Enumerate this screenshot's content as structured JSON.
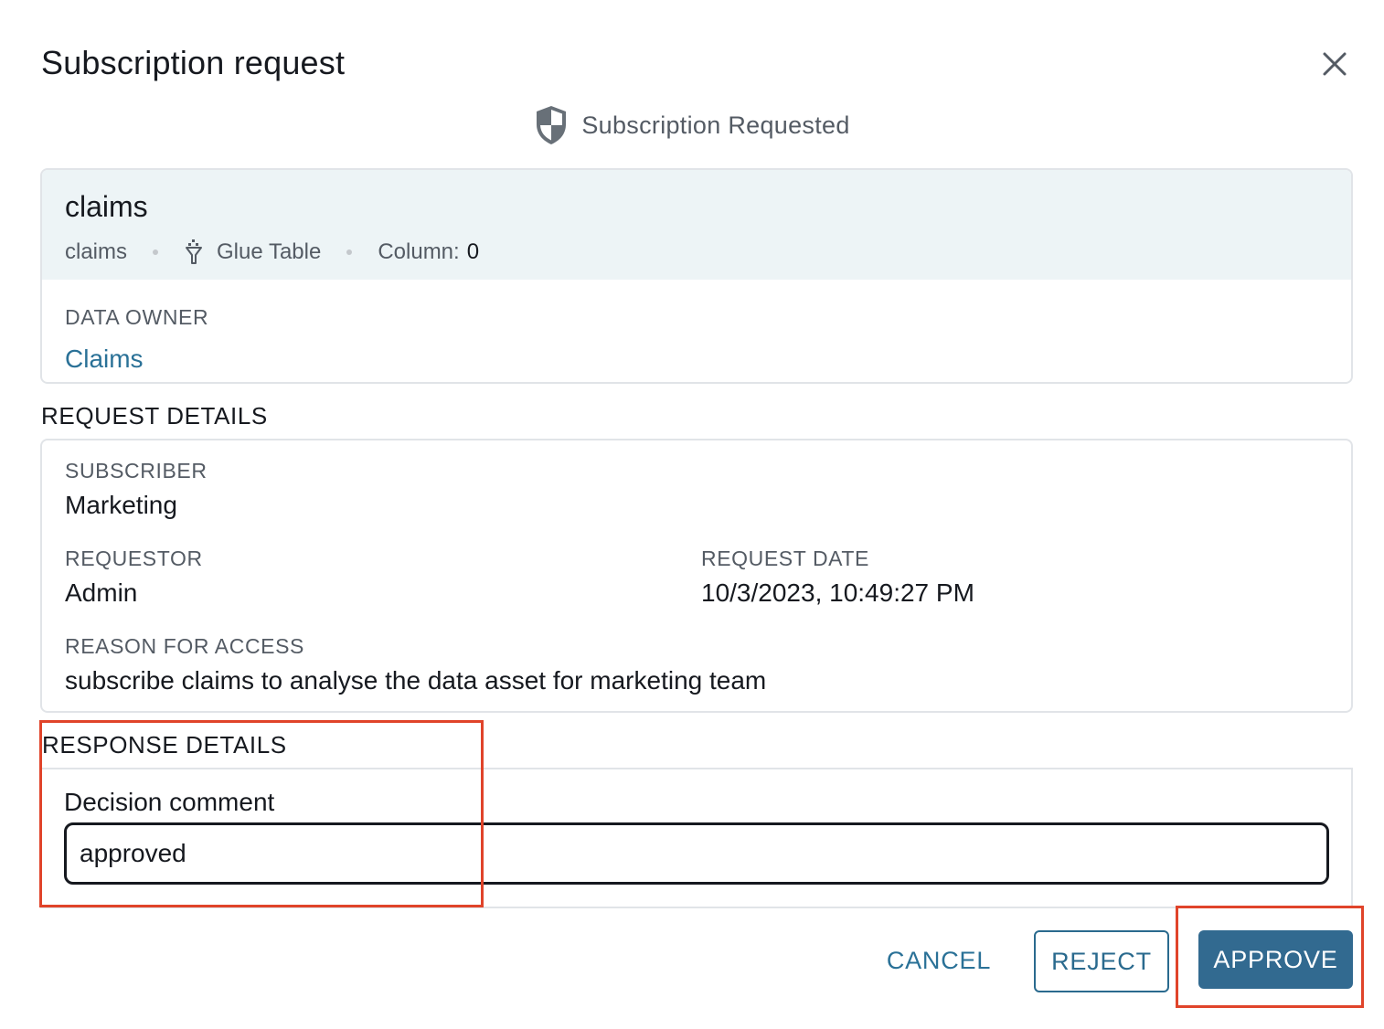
{
  "dialog": {
    "title": "Subscription request",
    "status": "Subscription Requested",
    "colors": {
      "accent": "#2a7197",
      "primary_button": "#326a90",
      "highlight": "#e0442a"
    }
  },
  "asset": {
    "name": "claims",
    "meta_name": "claims",
    "type_icon": "glue-table-icon",
    "type": "Glue Table",
    "column_label": "Column:",
    "column_count": "0",
    "data_owner_label": "DATA OWNER",
    "data_owner": "Claims"
  },
  "request_details": {
    "heading": "REQUEST DETAILS",
    "subscriber_label": "SUBSCRIBER",
    "subscriber": "Marketing",
    "requestor_label": "REQUESTOR",
    "requestor": "Admin",
    "request_date_label": "REQUEST DATE",
    "request_date": "10/3/2023, 10:49:27 PM",
    "reason_label": "REASON FOR ACCESS",
    "reason": "subscribe claims to analyse the data asset for marketing team"
  },
  "response_details": {
    "heading": "RESPONSE DETAILS",
    "comment_label": "Decision comment",
    "comment_value": "approved"
  },
  "actions": {
    "cancel": "CANCEL",
    "reject": "REJECT",
    "approve": "APPROVE"
  }
}
